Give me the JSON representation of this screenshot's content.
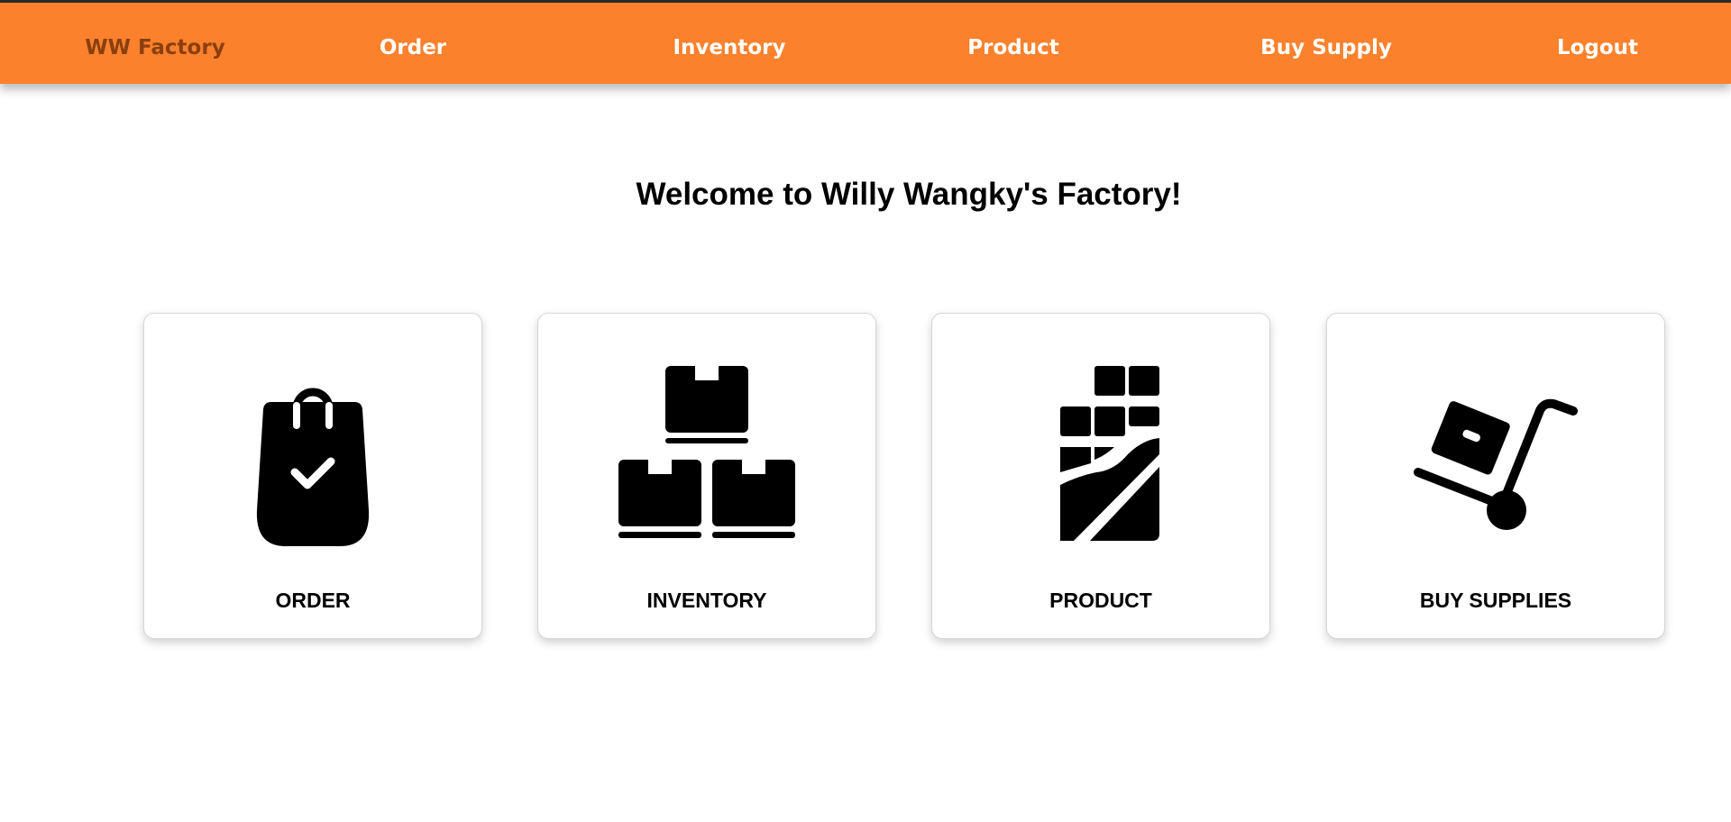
{
  "navbar": {
    "brand": "WW Factory",
    "items": [
      {
        "label": "Order"
      },
      {
        "label": "Inventory"
      },
      {
        "label": "Product"
      },
      {
        "label": "Buy Supply"
      },
      {
        "label": "Logout"
      }
    ],
    "colors": {
      "background": "#fb812c",
      "brand_text": "#8a3f10",
      "item_text": "#ffffff"
    }
  },
  "main": {
    "title": "Welcome to Willy Wangky's Factory!",
    "cards": [
      {
        "label": "ORDER",
        "icon": "shopping-bag-check-icon"
      },
      {
        "label": "INVENTORY",
        "icon": "stacked-boxes-icon"
      },
      {
        "label": "PRODUCT",
        "icon": "chocolate-bar-icon"
      },
      {
        "label": "BUY SUPPLIES",
        "icon": "hand-truck-icon"
      }
    ]
  }
}
